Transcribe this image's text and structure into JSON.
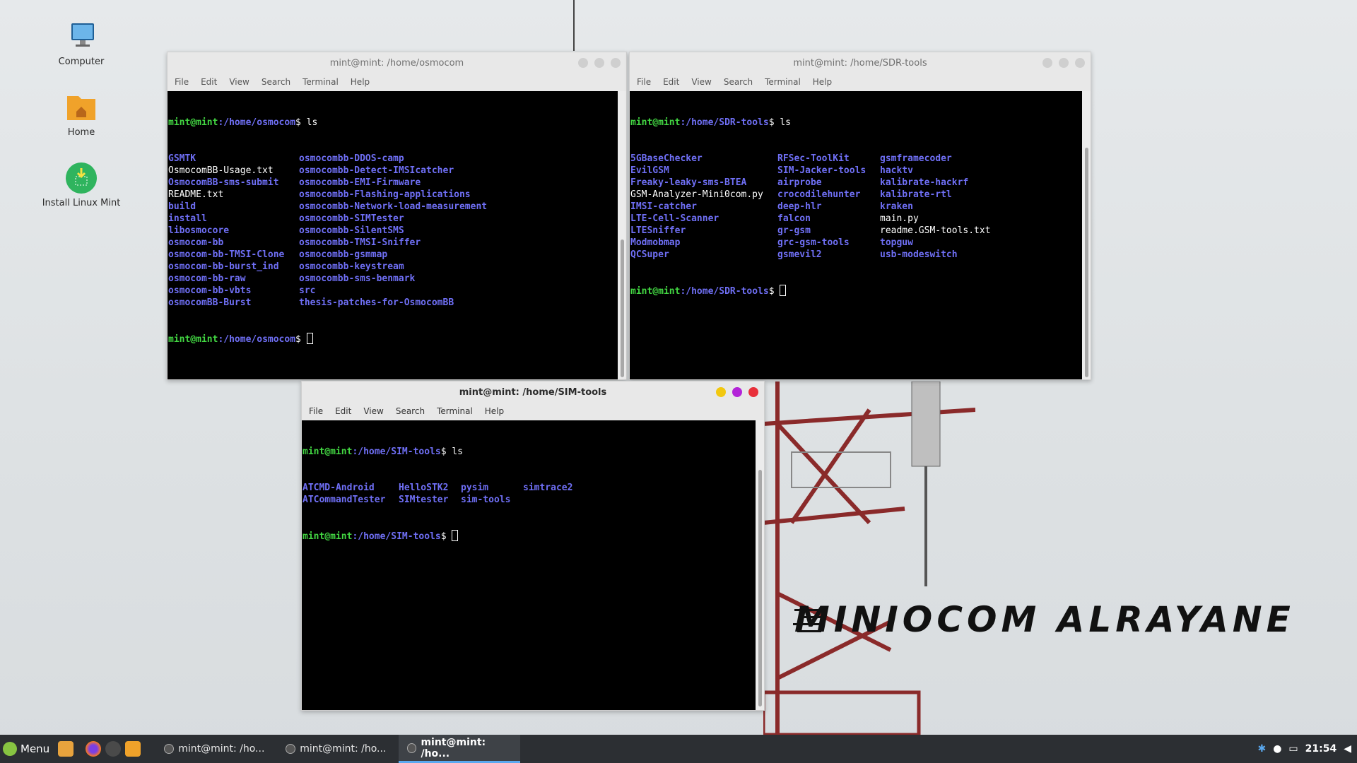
{
  "desktop": {
    "icons": [
      {
        "label": "Computer"
      },
      {
        "label": "Home"
      },
      {
        "label": "Install Linux Mint"
      }
    ],
    "wallpaper_text": "MINIOCOM ALRAYANE"
  },
  "menu_labels": [
    "File",
    "Edit",
    "View",
    "Search",
    "Terminal",
    "Help"
  ],
  "windows": {
    "osmocom": {
      "title": "mint@mint: /home/osmocom",
      "prompt_user": "mint@mint",
      "prompt_path": ":/home/osmocom",
      "command": "$ ls",
      "col1": [
        {
          "text": "GSMTK",
          "type": "dir"
        },
        {
          "text": "OsmocomBB-Usage.txt",
          "type": "file"
        },
        {
          "text": "OsmocomBB-sms-submit",
          "type": "dir"
        },
        {
          "text": "README.txt",
          "type": "file"
        },
        {
          "text": "build",
          "type": "dir"
        },
        {
          "text": "install",
          "type": "dir"
        },
        {
          "text": "libosmocore",
          "type": "dir"
        },
        {
          "text": "osmocom-bb",
          "type": "dir"
        },
        {
          "text": "osmocom-bb-TMSI-Clone",
          "type": "dir"
        },
        {
          "text": "osmocom-bb-burst_ind",
          "type": "dir"
        },
        {
          "text": "osmocom-bb-raw",
          "type": "dir"
        },
        {
          "text": "osmocom-bb-vbts",
          "type": "dir"
        },
        {
          "text": "osmocomBB-Burst",
          "type": "dir"
        }
      ],
      "col2": [
        {
          "text": "osmocombb-DDOS-camp",
          "type": "dir"
        },
        {
          "text": "osmocombb-Detect-IMSIcatcher",
          "type": "dir"
        },
        {
          "text": "osmocombb-EMI-Firmware",
          "type": "dir"
        },
        {
          "text": "osmocombb-Flashing-applications",
          "type": "dir"
        },
        {
          "text": "osmocombb-Network-load-measurement",
          "type": "dir"
        },
        {
          "text": "osmocombb-SIMTester",
          "type": "dir"
        },
        {
          "text": "osmocombb-SilentSMS",
          "type": "dir"
        },
        {
          "text": "osmocombb-TMSI-Sniffer",
          "type": "dir"
        },
        {
          "text": "osmocombb-gsmmap",
          "type": "dir"
        },
        {
          "text": "osmocombb-keystream",
          "type": "dir"
        },
        {
          "text": "osmocombb-sms-benmark",
          "type": "dir"
        },
        {
          "text": "src",
          "type": "dir"
        },
        {
          "text": "thesis-patches-for-OsmocomBB",
          "type": "dir"
        }
      ],
      "end_prompt": "$ "
    },
    "sdr": {
      "title": "mint@mint: /home/SDR-tools",
      "prompt_user": "mint@mint",
      "prompt_path": ":/home/SDR-tools",
      "command": "$ ls",
      "col1": [
        {
          "text": "5GBaseChecker",
          "type": "dir"
        },
        {
          "text": "EvilGSM",
          "type": "dir"
        },
        {
          "text": "Freaky-leaky-sms-BTEA",
          "type": "dir"
        },
        {
          "text": "GSM-Analyzer-Mini0com.py",
          "type": "file"
        },
        {
          "text": "IMSI-catcher",
          "type": "dir"
        },
        {
          "text": "LTE-Cell-Scanner",
          "type": "dir"
        },
        {
          "text": "LTESniffer",
          "type": "dir"
        },
        {
          "text": "Modmobmap",
          "type": "dir"
        },
        {
          "text": "QCSuper",
          "type": "dir"
        }
      ],
      "col2": [
        {
          "text": "RFSec-ToolKit",
          "type": "dir"
        },
        {
          "text": "SIM-Jacker-tools",
          "type": "dir"
        },
        {
          "text": "airprobe",
          "type": "dir"
        },
        {
          "text": "crocodilehunter",
          "type": "dir"
        },
        {
          "text": "deep-hlr",
          "type": "dir"
        },
        {
          "text": "falcon",
          "type": "dir"
        },
        {
          "text": "gr-gsm",
          "type": "dir"
        },
        {
          "text": "grc-gsm-tools",
          "type": "dir"
        },
        {
          "text": "gsmevil2",
          "type": "dir"
        }
      ],
      "col3": [
        {
          "text": "gsmframecoder",
          "type": "dir"
        },
        {
          "text": "hacktv",
          "type": "dir"
        },
        {
          "text": "kalibrate-hackrf",
          "type": "dir"
        },
        {
          "text": "kalibrate-rtl",
          "type": "dir"
        },
        {
          "text": "kraken",
          "type": "dir"
        },
        {
          "text": "main.py",
          "type": "file"
        },
        {
          "text": "readme.GSM-tools.txt",
          "type": "file"
        },
        {
          "text": "topguw",
          "type": "dir"
        },
        {
          "text": "usb-modeswitch",
          "type": "dir"
        }
      ],
      "end_prompt": "$ "
    },
    "sim": {
      "title": "mint@mint: /home/SIM-tools",
      "prompt_user": "mint@mint",
      "prompt_path": ":/home/SIM-tools",
      "command": "$ ls",
      "col1": [
        {
          "text": "ATCMD-Android",
          "type": "dir"
        },
        {
          "text": "ATCommandTester",
          "type": "dir"
        }
      ],
      "col2": [
        {
          "text": "HelloSTK2",
          "type": "dir"
        },
        {
          "text": "SIMtester",
          "type": "dir"
        }
      ],
      "col3": [
        {
          "text": "pysim",
          "type": "dir"
        },
        {
          "text": "sim-tools",
          "type": "dir"
        }
      ],
      "col4": [
        {
          "text": "simtrace2",
          "type": "dir"
        },
        {
          "text": "",
          "type": "dir"
        }
      ],
      "end_prompt": "$ "
    }
  },
  "taskbar": {
    "menu_label": "Menu",
    "tasks": [
      {
        "label": "mint@mint: /ho..."
      },
      {
        "label": "mint@mint: /ho..."
      },
      {
        "label": "mint@mint: /ho..."
      }
    ],
    "clock": "21:54"
  },
  "colors": {
    "prompt_user": "#42d642",
    "directory": "#6f6ff5",
    "close_active": "#e8303a",
    "maximize_active": "#b324d8",
    "minimize_active": "#f2c80f",
    "accent": "#5aa9f0"
  }
}
